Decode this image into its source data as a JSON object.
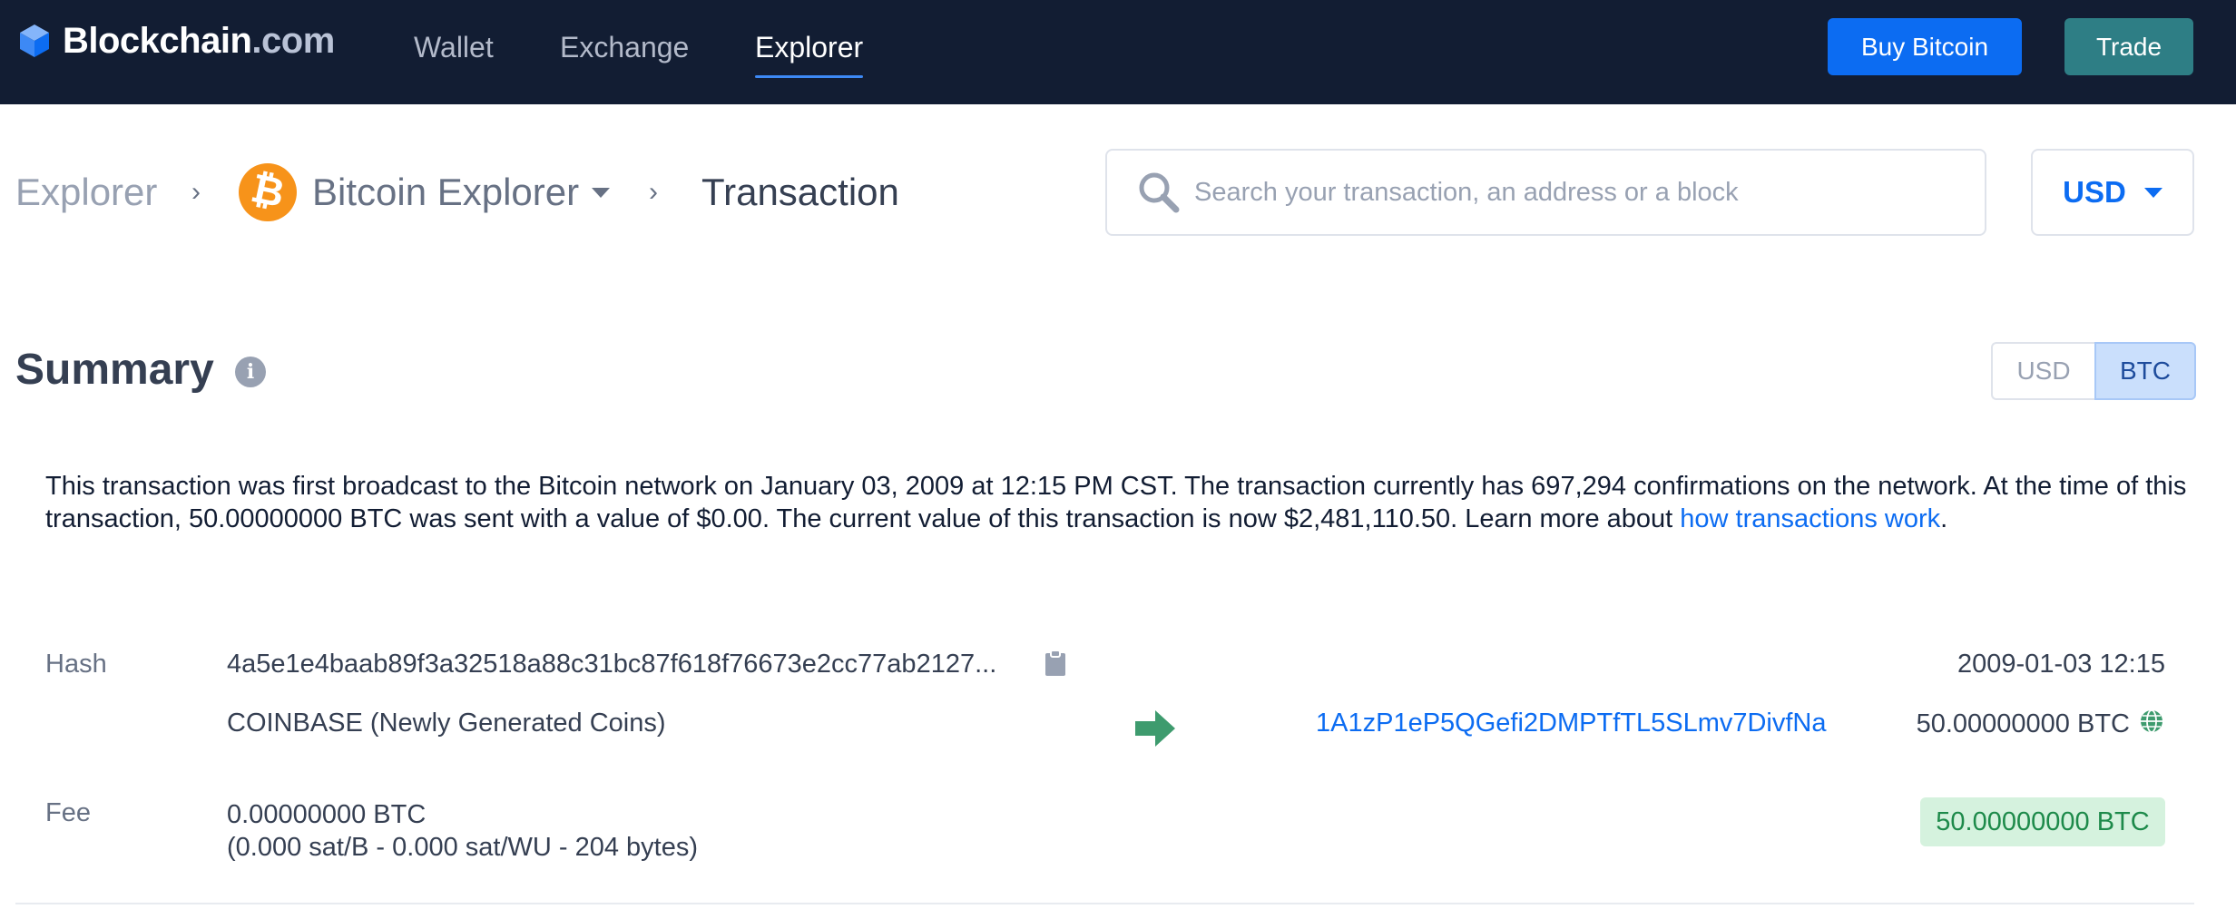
{
  "header": {
    "logo_name": "Blockchain",
    "logo_domain": ".com",
    "nav": [
      "Wallet",
      "Exchange",
      "Explorer"
    ],
    "active_nav": "Explorer",
    "buy_label": "Buy Bitcoin",
    "trade_label": "Trade",
    "colors": {
      "background": "#121D33",
      "buy": "#0C6CF2",
      "trade": "#2E7E85"
    }
  },
  "breadcrumb": {
    "root": "Explorer",
    "separator": "›",
    "coin_icon": "bitcoin-icon",
    "explorer": "Bitcoin Explorer",
    "current": "Transaction"
  },
  "search": {
    "placeholder": "Search your transaction, an address or a block",
    "value": ""
  },
  "currency": {
    "selected": "USD"
  },
  "summary": {
    "title": "Summary",
    "toggle": {
      "options": [
        "USD",
        "BTC"
      ],
      "selected": "BTC"
    },
    "description": "This transaction was first broadcast to the Bitcoin network on January 03, 2009 at 12:15 PM CST.  The transaction currently has 697,294 confirmations on the network.  At the time of this transaction, 50.00000000 BTC was sent with a value of $0.00. The current value of this transaction is now $2,481,110.50.  Learn more about ",
    "link_text": "how transactions work",
    "description_end": "."
  },
  "transaction": {
    "hash_label": "Hash",
    "hash": "4a5e1e4baab89f3a32518a88c31bc87f618f76673e2cc77ab2127...",
    "date": "2009-01-03 12:15",
    "input": "COINBASE (Newly Generated Coins)",
    "output_address": "1A1zP1eP5QGefi2DMPTfTL5SLmv7DivfNa",
    "output_amount": "50.00000000 BTC",
    "fee_label": "Fee",
    "fee": "0.00000000 BTC",
    "fee_detail": "(0.000 sat/B - 0.000 sat/WU - 204 bytes)",
    "total": "50.00000000 BTC",
    "icons": [
      "clipboard-icon",
      "arrow-right-icon",
      "globe-icon"
    ]
  }
}
